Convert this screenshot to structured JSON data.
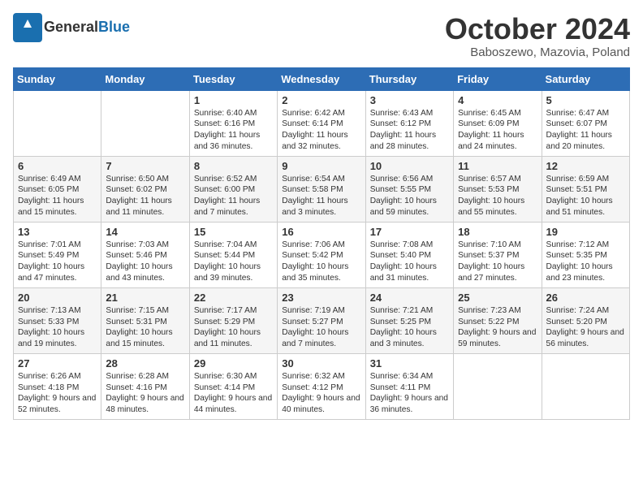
{
  "header": {
    "logo_general": "General",
    "logo_blue": "Blue",
    "month_title": "October 2024",
    "subtitle": "Baboszewo, Mazovia, Poland"
  },
  "days_of_week": [
    "Sunday",
    "Monday",
    "Tuesday",
    "Wednesday",
    "Thursday",
    "Friday",
    "Saturday"
  ],
  "weeks": [
    [
      {
        "day": "",
        "sunrise": "",
        "sunset": "",
        "daylight": ""
      },
      {
        "day": "",
        "sunrise": "",
        "sunset": "",
        "daylight": ""
      },
      {
        "day": "1",
        "sunrise": "Sunrise: 6:40 AM",
        "sunset": "Sunset: 6:16 PM",
        "daylight": "Daylight: 11 hours and 36 minutes."
      },
      {
        "day": "2",
        "sunrise": "Sunrise: 6:42 AM",
        "sunset": "Sunset: 6:14 PM",
        "daylight": "Daylight: 11 hours and 32 minutes."
      },
      {
        "day": "3",
        "sunrise": "Sunrise: 6:43 AM",
        "sunset": "Sunset: 6:12 PM",
        "daylight": "Daylight: 11 hours and 28 minutes."
      },
      {
        "day": "4",
        "sunrise": "Sunrise: 6:45 AM",
        "sunset": "Sunset: 6:09 PM",
        "daylight": "Daylight: 11 hours and 24 minutes."
      },
      {
        "day": "5",
        "sunrise": "Sunrise: 6:47 AM",
        "sunset": "Sunset: 6:07 PM",
        "daylight": "Daylight: 11 hours and 20 minutes."
      }
    ],
    [
      {
        "day": "6",
        "sunrise": "Sunrise: 6:49 AM",
        "sunset": "Sunset: 6:05 PM",
        "daylight": "Daylight: 11 hours and 15 minutes."
      },
      {
        "day": "7",
        "sunrise": "Sunrise: 6:50 AM",
        "sunset": "Sunset: 6:02 PM",
        "daylight": "Daylight: 11 hours and 11 minutes."
      },
      {
        "day": "8",
        "sunrise": "Sunrise: 6:52 AM",
        "sunset": "Sunset: 6:00 PM",
        "daylight": "Daylight: 11 hours and 7 minutes."
      },
      {
        "day": "9",
        "sunrise": "Sunrise: 6:54 AM",
        "sunset": "Sunset: 5:58 PM",
        "daylight": "Daylight: 11 hours and 3 minutes."
      },
      {
        "day": "10",
        "sunrise": "Sunrise: 6:56 AM",
        "sunset": "Sunset: 5:55 PM",
        "daylight": "Daylight: 10 hours and 59 minutes."
      },
      {
        "day": "11",
        "sunrise": "Sunrise: 6:57 AM",
        "sunset": "Sunset: 5:53 PM",
        "daylight": "Daylight: 10 hours and 55 minutes."
      },
      {
        "day": "12",
        "sunrise": "Sunrise: 6:59 AM",
        "sunset": "Sunset: 5:51 PM",
        "daylight": "Daylight: 10 hours and 51 minutes."
      }
    ],
    [
      {
        "day": "13",
        "sunrise": "Sunrise: 7:01 AM",
        "sunset": "Sunset: 5:49 PM",
        "daylight": "Daylight: 10 hours and 47 minutes."
      },
      {
        "day": "14",
        "sunrise": "Sunrise: 7:03 AM",
        "sunset": "Sunset: 5:46 PM",
        "daylight": "Daylight: 10 hours and 43 minutes."
      },
      {
        "day": "15",
        "sunrise": "Sunrise: 7:04 AM",
        "sunset": "Sunset: 5:44 PM",
        "daylight": "Daylight: 10 hours and 39 minutes."
      },
      {
        "day": "16",
        "sunrise": "Sunrise: 7:06 AM",
        "sunset": "Sunset: 5:42 PM",
        "daylight": "Daylight: 10 hours and 35 minutes."
      },
      {
        "day": "17",
        "sunrise": "Sunrise: 7:08 AM",
        "sunset": "Sunset: 5:40 PM",
        "daylight": "Daylight: 10 hours and 31 minutes."
      },
      {
        "day": "18",
        "sunrise": "Sunrise: 7:10 AM",
        "sunset": "Sunset: 5:37 PM",
        "daylight": "Daylight: 10 hours and 27 minutes."
      },
      {
        "day": "19",
        "sunrise": "Sunrise: 7:12 AM",
        "sunset": "Sunset: 5:35 PM",
        "daylight": "Daylight: 10 hours and 23 minutes."
      }
    ],
    [
      {
        "day": "20",
        "sunrise": "Sunrise: 7:13 AM",
        "sunset": "Sunset: 5:33 PM",
        "daylight": "Daylight: 10 hours and 19 minutes."
      },
      {
        "day": "21",
        "sunrise": "Sunrise: 7:15 AM",
        "sunset": "Sunset: 5:31 PM",
        "daylight": "Daylight: 10 hours and 15 minutes."
      },
      {
        "day": "22",
        "sunrise": "Sunrise: 7:17 AM",
        "sunset": "Sunset: 5:29 PM",
        "daylight": "Daylight: 10 hours and 11 minutes."
      },
      {
        "day": "23",
        "sunrise": "Sunrise: 7:19 AM",
        "sunset": "Sunset: 5:27 PM",
        "daylight": "Daylight: 10 hours and 7 minutes."
      },
      {
        "day": "24",
        "sunrise": "Sunrise: 7:21 AM",
        "sunset": "Sunset: 5:25 PM",
        "daylight": "Daylight: 10 hours and 3 minutes."
      },
      {
        "day": "25",
        "sunrise": "Sunrise: 7:23 AM",
        "sunset": "Sunset: 5:22 PM",
        "daylight": "Daylight: 9 hours and 59 minutes."
      },
      {
        "day": "26",
        "sunrise": "Sunrise: 7:24 AM",
        "sunset": "Sunset: 5:20 PM",
        "daylight": "Daylight: 9 hours and 56 minutes."
      }
    ],
    [
      {
        "day": "27",
        "sunrise": "Sunrise: 6:26 AM",
        "sunset": "Sunset: 4:18 PM",
        "daylight": "Daylight: 9 hours and 52 minutes."
      },
      {
        "day": "28",
        "sunrise": "Sunrise: 6:28 AM",
        "sunset": "Sunset: 4:16 PM",
        "daylight": "Daylight: 9 hours and 48 minutes."
      },
      {
        "day": "29",
        "sunrise": "Sunrise: 6:30 AM",
        "sunset": "Sunset: 4:14 PM",
        "daylight": "Daylight: 9 hours and 44 minutes."
      },
      {
        "day": "30",
        "sunrise": "Sunrise: 6:32 AM",
        "sunset": "Sunset: 4:12 PM",
        "daylight": "Daylight: 9 hours and 40 minutes."
      },
      {
        "day": "31",
        "sunrise": "Sunrise: 6:34 AM",
        "sunset": "Sunset: 4:11 PM",
        "daylight": "Daylight: 9 hours and 36 minutes."
      },
      {
        "day": "",
        "sunrise": "",
        "sunset": "",
        "daylight": ""
      },
      {
        "day": "",
        "sunrise": "",
        "sunset": "",
        "daylight": ""
      }
    ]
  ]
}
